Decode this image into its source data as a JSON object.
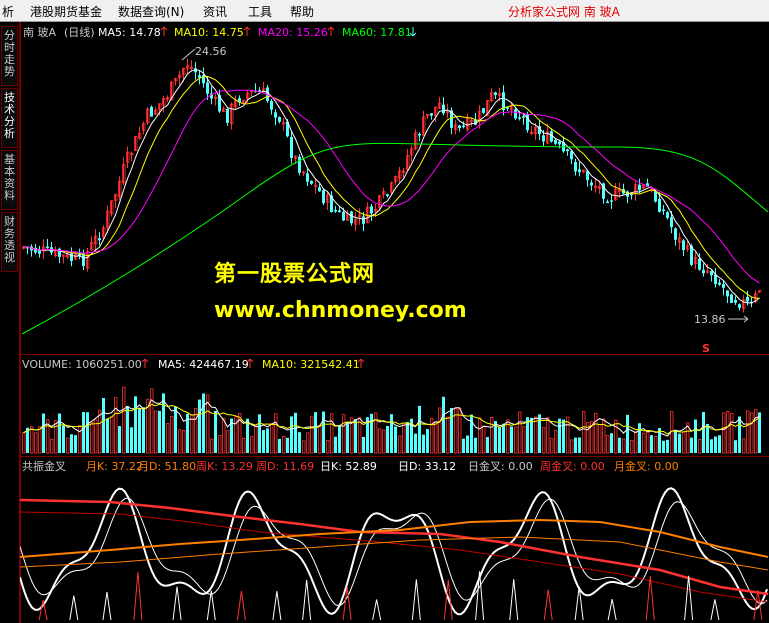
{
  "menu": {
    "items": [
      "析",
      "港股期货基金",
      "数据查询(N)",
      "资讯",
      "工具",
      "帮助"
    ],
    "right_title": "分析家公式网  南   玻A"
  },
  "sidebar": {
    "tabs": [
      "分时走势",
      "技术分析",
      "基本资料",
      "财务透视"
    ]
  },
  "price_panel": {
    "stock": "南   玻A",
    "period": "(日线)",
    "ma5": "MA5: 14.78",
    "ma10": "MA10: 14.75",
    "ma20": "MA20: 15.26",
    "ma60": "MA60: 17.81",
    "high_label": "24.56",
    "low_label": "13.86",
    "marker": "S"
  },
  "volume_panel": {
    "volume": "VOLUME: 1060251.00",
    "ma5": "MA5: 424467.19",
    "ma10": "MA10: 321542.41"
  },
  "indicator_panel": {
    "name": "共振金叉",
    "month_k": "月K: 37.22",
    "month_d": "月D: 51.80",
    "week_k": "周K: 13.29",
    "week_d": "周D: 11.69",
    "day_k": "日K: 52.89",
    "day_d": "日D: 33.12",
    "day_cross": "日金叉: 0.00",
    "week_cross": "周金叉: 0.00",
    "month_cross": "月金叉: 0.00"
  },
  "watermark": {
    "line1": "第一股票公式网",
    "line2": "www.chnmoney.com"
  },
  "colors": {
    "up": "#ff3232",
    "down": "#54ffff",
    "ma5": "#ffffff",
    "ma10": "#ffff00",
    "ma20": "#ff00ff",
    "ma60": "#00ff00",
    "grid": "#800000"
  }
}
